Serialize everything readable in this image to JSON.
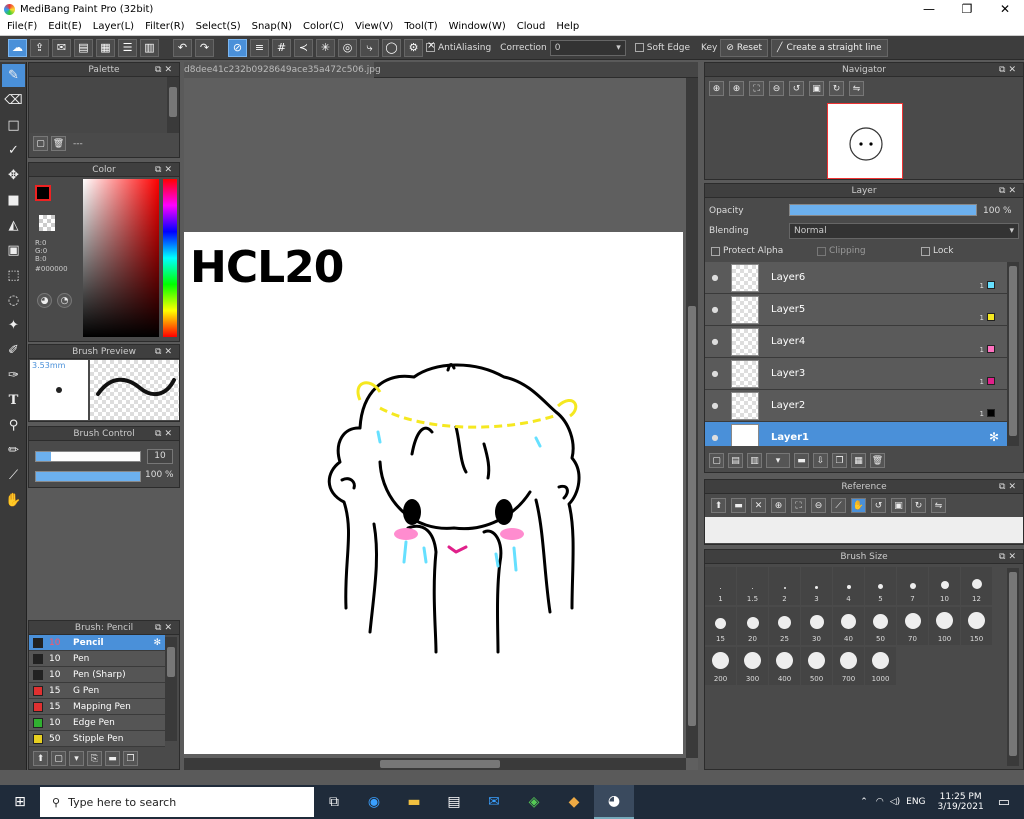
{
  "window": {
    "title": "MediBang Paint Pro (32bit)",
    "minimize": "—",
    "maximize": "❐",
    "close": "✕"
  },
  "menu": [
    "File(F)",
    "Edit(E)",
    "Layer(L)",
    "Filter(R)",
    "Select(S)",
    "Snap(N)",
    "Color(C)",
    "View(V)",
    "Tool(T)",
    "Window(W)",
    "Cloud",
    "Help"
  ],
  "toolbar": {
    "antialiasing": "AntiAliasing",
    "correction_label": "Correction",
    "correction_value": "0",
    "soft_edge": "Soft Edge",
    "key_label": "Key",
    "reset": "Reset",
    "straight_line": "Create a straight line"
  },
  "palette": {
    "title": "Palette",
    "empty_label": "---"
  },
  "color": {
    "title": "Color",
    "r": "R:0",
    "g": "G:0",
    "b": "B:0",
    "hex": "#000000",
    "fg": "#000000",
    "bg": "#ffffff"
  },
  "brush_preview": {
    "title": "Brush Preview",
    "size": "3.53mm"
  },
  "brush_control": {
    "title": "Brush Control",
    "size_value": "10",
    "opacity_value": "100 %",
    "size_fill": 0.14,
    "opacity_fill": 1.0
  },
  "brush_list": {
    "title": "Brush: Pencil",
    "items": [
      {
        "size": "10",
        "name": "Pencil",
        "color": "#222222"
      },
      {
        "size": "10",
        "name": "Pen",
        "color": "#222222"
      },
      {
        "size": "10",
        "name": "Pen (Sharp)",
        "color": "#222222"
      },
      {
        "size": "15",
        "name": "G Pen",
        "color": "#e03030"
      },
      {
        "size": "15",
        "name": "Mapping Pen",
        "color": "#e03030"
      },
      {
        "size": "10",
        "name": "Edge Pen",
        "color": "#30b030"
      },
      {
        "size": "50",
        "name": "Stipple Pen",
        "color": "#e8d020"
      }
    ]
  },
  "document": {
    "tab": "d8dee41c232b0928649ace35a472c506.jpg",
    "canvas_text": "HCL20"
  },
  "navigator": {
    "title": "Navigator"
  },
  "layer": {
    "title": "Layer",
    "opacity_label": "Opacity",
    "opacity_value": "100 %",
    "opacity_fill": 1.0,
    "blending_label": "Blending",
    "blending_value": "Normal",
    "protect_alpha": "Protect Alpha",
    "clipping": "Clipping",
    "lock": "Lock",
    "layers": [
      {
        "name": "Layer6",
        "num": "1",
        "color": "#66e0ff"
      },
      {
        "name": "Layer5",
        "num": "1",
        "color": "#f5e820"
      },
      {
        "name": "Layer4",
        "num": "1",
        "color": "#ff70c0"
      },
      {
        "name": "Layer3",
        "num": "1",
        "color": "#e0208a"
      },
      {
        "name": "Layer2",
        "num": "1",
        "color": "#000000"
      },
      {
        "name": "Layer1",
        "num": "",
        "color": ""
      }
    ]
  },
  "reference": {
    "title": "Reference"
  },
  "brush_size": {
    "title": "Brush Size",
    "sizes": [
      "1",
      "1.5",
      "2",
      "3",
      "4",
      "5",
      "7",
      "10",
      "12",
      "15",
      "20",
      "25",
      "30",
      "40",
      "50",
      "70",
      "100",
      "150",
      "200",
      "300",
      "400",
      "500",
      "700",
      "1000"
    ]
  },
  "taskbar": {
    "search_placeholder": "Type here to search",
    "lang": "ENG",
    "time": "11:25 PM",
    "date": "3/19/2021"
  }
}
